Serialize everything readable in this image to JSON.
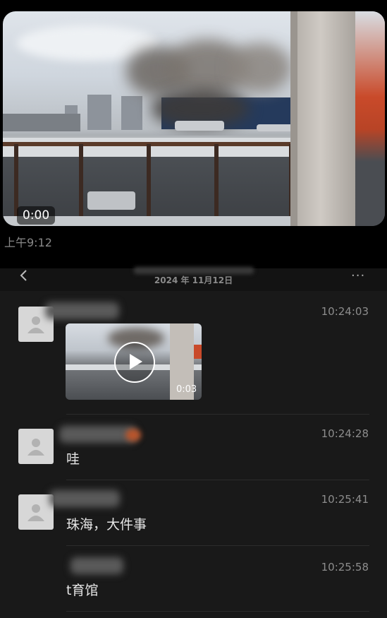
{
  "top_video": {
    "duration": "0:00",
    "sent_time": "上午9:12"
  },
  "chat": {
    "date_label": "2024 年 11月12日",
    "messages": [
      {
        "time": "10:24:03",
        "type": "video",
        "video_duration": "0:03"
      },
      {
        "time": "10:24:28",
        "type": "text",
        "text": "哇"
      },
      {
        "time": "10:25:41",
        "type": "text",
        "text": "珠海，大件事"
      },
      {
        "time": "10:25:58",
        "type": "text",
        "text": "t育馆"
      }
    ]
  },
  "icons": {
    "back": "chevron-left-icon",
    "more": "more-icon",
    "play": "play-icon",
    "avatar": "default-avatar-icon"
  }
}
